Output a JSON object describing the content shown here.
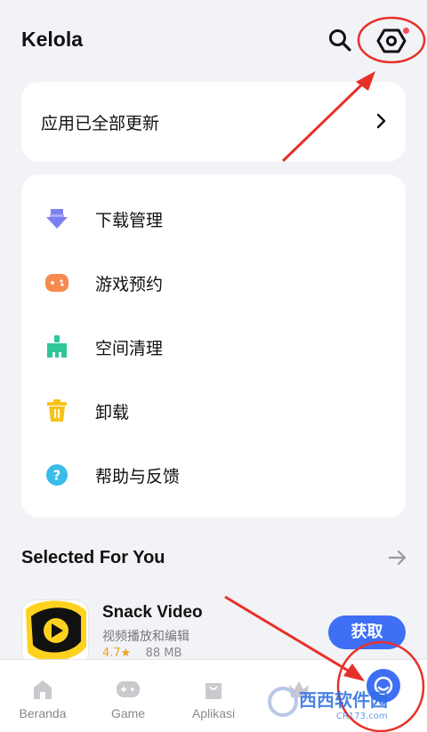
{
  "header": {
    "title": "Kelola"
  },
  "update": {
    "label": "应用已全部更新"
  },
  "menu": {
    "items": [
      {
        "label": "下载管理",
        "icon": "download-icon",
        "color": "#7b7ff0"
      },
      {
        "label": "游戏预约",
        "icon": "game-reserve-icon",
        "color": "#f5894e"
      },
      {
        "label": "空间清理",
        "icon": "cleanup-icon",
        "color": "#2fc69a"
      },
      {
        "label": "卸载",
        "icon": "trash-icon",
        "color": "#f6c319"
      },
      {
        "label": "帮助与反馈",
        "icon": "help-icon",
        "color": "#3bbce8"
      }
    ]
  },
  "recommend": {
    "title": "Selected For You",
    "app": {
      "name": "Snack Video",
      "desc": "视频播放和编辑",
      "rating": "4.7★",
      "size": "88 MB",
      "button": "获取"
    }
  },
  "tabs": [
    {
      "label": "Beranda",
      "icon": "home-icon"
    },
    {
      "label": "Game",
      "icon": "gamepad-icon"
    },
    {
      "label": "Aplikasi",
      "icon": "bag-icon"
    },
    {
      "label": "",
      "icon": "crown-icon"
    },
    {
      "label": "",
      "icon": "profile-icon"
    }
  ],
  "watermark": "西西软件园 CR173.com",
  "colors": {
    "accent": "#3f6ff5",
    "annotation": "#e8302a",
    "badge": "#f0525e"
  }
}
